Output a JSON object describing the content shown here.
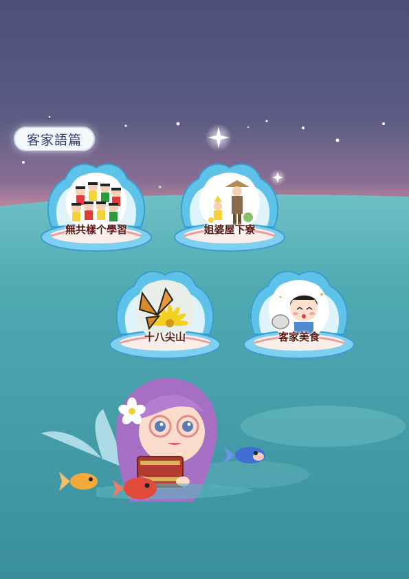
{
  "badge": {
    "label": "客家語篇"
  },
  "menu": {
    "items": [
      {
        "label": "無共樣个學習",
        "icon": "children-group-illustration"
      },
      {
        "label": "姐婆屋下寮",
        "icon": "grandmother-visit-illustration"
      },
      {
        "label": "十八尖山",
        "icon": "butterfly-flower-illustration"
      },
      {
        "label": "客家美食",
        "icon": "boy-eating-illustration"
      }
    ]
  },
  "colors": {
    "sky_top": "#4a5078",
    "sky_horizon": "#b87c96",
    "sea": "#4aa6ad",
    "shell": "#5fc2e8",
    "shell_inner": "#fbeee8",
    "hair": "#a66fc4"
  }
}
